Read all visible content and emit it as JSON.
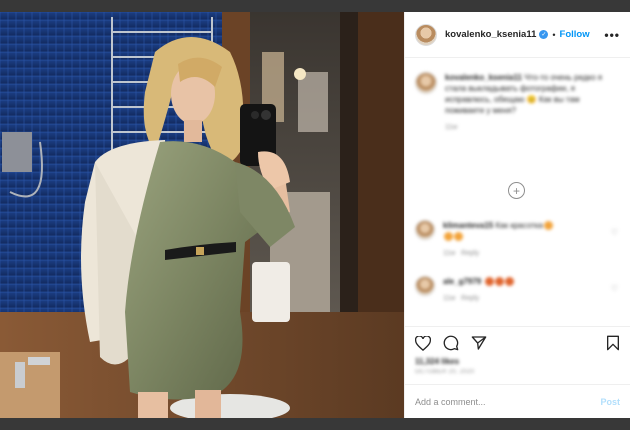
{
  "post": {
    "username": "kovalenko_ksenia11",
    "follow_label": "Follow",
    "dot": "•",
    "more_label": "•••"
  },
  "caption": {
    "username": "kovalenko_ksenia11",
    "text": "Что-то очень редко я стала выкладывать фотографии, я исправлюсь, обещаю 😊 Как вы там поживаете у меня?",
    "time": "11w"
  },
  "comments": [
    {
      "username": "klimanteva15",
      "text": "Как красотка",
      "time": "11w",
      "reply_label": "Reply"
    },
    {
      "username": "ale_g7979",
      "text": "",
      "time": "11w",
      "reply_label": "Reply"
    }
  ],
  "actions": {
    "likes": "11,324 likes",
    "date": "OCTOBER 20, 2020"
  },
  "comment_box": {
    "placeholder": "Add a comment...",
    "post_label": "Post"
  },
  "colors": {
    "accent": "#0095f6",
    "backdrop": "#383838",
    "post_disabled": "#b2dffc"
  },
  "icons": [
    "heart-icon",
    "comment-icon",
    "share-icon",
    "bookmark-icon",
    "verified-badge-icon",
    "more-options-icon",
    "load-more-icon"
  ]
}
